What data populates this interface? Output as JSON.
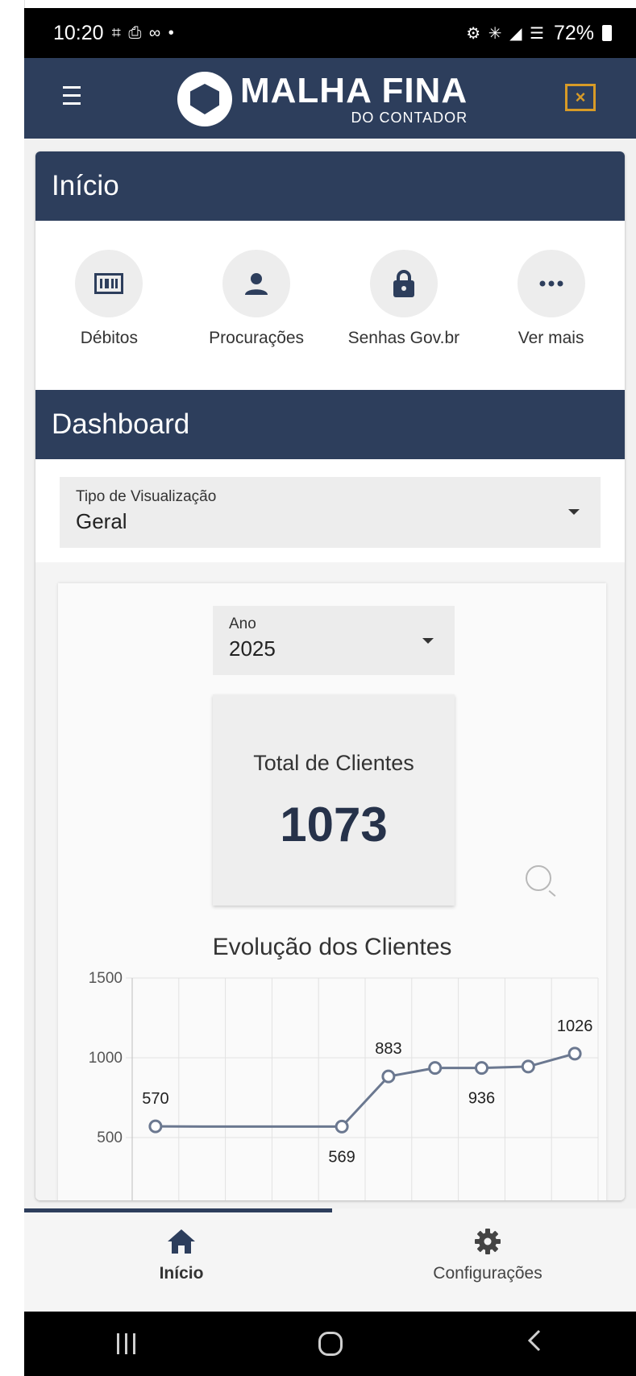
{
  "status_bar": {
    "time": "10:20",
    "left_icons": "⌗ ⎙ ∞ •",
    "battery": "72%"
  },
  "app_bar": {
    "logo_title": "MALHA FINA",
    "logo_subtitle": "DO CONTADOR",
    "close_label": "×"
  },
  "inicio": {
    "title": "Início",
    "shortcuts": [
      {
        "label": "Débitos",
        "icon": "barcode-icon"
      },
      {
        "label": "Procurações",
        "icon": "person-icon"
      },
      {
        "label": "Senhas Gov.br",
        "icon": "lock-icon"
      },
      {
        "label": "Ver mais",
        "icon": "more-icon"
      }
    ]
  },
  "dashboard": {
    "title": "Dashboard",
    "view_type_label": "Tipo de Visualização",
    "view_type_value": "Geral",
    "year_label": "Ano",
    "year_value": "2025",
    "total_label": "Total de Clientes",
    "total_value": "1073"
  },
  "chart_data": {
    "type": "line",
    "title": "Evolução dos Clientes",
    "xlabel": "",
    "ylabel": "",
    "ylim": [
      0,
      1500
    ],
    "yticks": [
      500,
      1000,
      1500
    ],
    "x": [
      1,
      2,
      3,
      4,
      5,
      6,
      7,
      8,
      9,
      10
    ],
    "values": [
      570,
      569,
      569,
      569,
      569,
      883,
      936,
      936,
      945,
      1026
    ],
    "data_labels": [
      {
        "index": 0,
        "text": "570",
        "pos": "above"
      },
      {
        "index": 4,
        "text": "569",
        "pos": "below"
      },
      {
        "index": 5,
        "text": "883",
        "pos": "above"
      },
      {
        "index": 7,
        "text": "936",
        "pos": "below"
      },
      {
        "index": 9,
        "text": "1026",
        "pos": "above"
      }
    ],
    "marker_indices": [
      0,
      4,
      5,
      6,
      7,
      8,
      9
    ],
    "line_color": "#6b7890",
    "grid": true
  },
  "bottom_nav": {
    "items": [
      {
        "label": "Início",
        "active": true
      },
      {
        "label": "Configurações",
        "active": false
      }
    ]
  },
  "colors": {
    "primary": "#2d3e5c",
    "accent": "#d89b27"
  }
}
